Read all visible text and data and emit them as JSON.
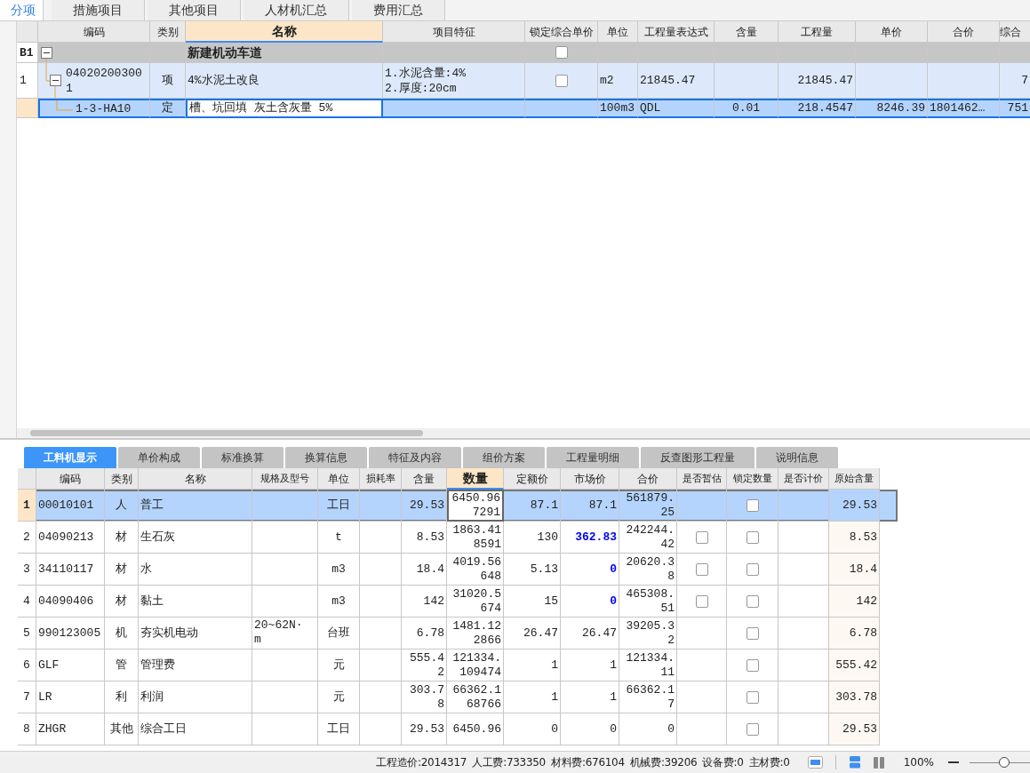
{
  "top_tabs": [
    {
      "label": "分项",
      "selected": true
    },
    {
      "label": "措施项目",
      "selected": false
    },
    {
      "label": "其他项目",
      "selected": false
    },
    {
      "label": "人材机汇总",
      "selected": false
    },
    {
      "label": "费用汇总",
      "selected": false
    }
  ],
  "top_grid": {
    "columns": [
      {
        "selected": false
      },
      {
        "label": "编码",
        "selected": false
      },
      {
        "label": "类别",
        "selected": false
      },
      {
        "label": "名称",
        "selected": true
      },
      {
        "label": "项目特征",
        "selected": false
      },
      {
        "label": "锁定综合单价",
        "selected": false
      },
      {
        "label": "单位",
        "selected": false
      },
      {
        "label": "工程量表达式",
        "selected": false
      },
      {
        "label": "含量",
        "selected": false
      },
      {
        "label": "工程量",
        "selected": false
      },
      {
        "label": "单价",
        "selected": false
      },
      {
        "label": "合价",
        "selected": false
      },
      {
        "label": "综合",
        "selected": false
      }
    ],
    "rows": [
      {
        "kind": "section",
        "row_header": "B1",
        "name": "新建机动车道",
        "locked": false,
        "expanded": true,
        "selected": false,
        "children": [
          {
            "kind": "item",
            "row_header": "1",
            "code": "040202003001",
            "type": "项",
            "name": "4%水泥土改良",
            "features": [
              "1.水泥含量:4%",
              "2.厚度:20cm"
            ],
            "locked": false,
            "unit": "m2",
            "expression": "21845.47",
            "quantity": "21845.47",
            "column_13": "7",
            "expanded": true,
            "selected": false,
            "children": [
              {
                "kind": "quota",
                "code": "1-3-HA10",
                "type": "定",
                "name": "槽、坑回填 灰土含灰量 5%",
                "unit": "100m3",
                "expression": "QDL",
                "content": "0.01",
                "quantity": "218.4547",
                "unit_price": "8246.39",
                "total": "1801462…",
                "column_13": "751",
                "selected": true
              }
            ]
          }
        ]
      }
    ]
  },
  "detail_tabs": [
    {
      "label": "工料机显示",
      "selected": true
    },
    {
      "label": "单价构成",
      "selected": false
    },
    {
      "label": "标准换算",
      "selected": false
    },
    {
      "label": "换算信息",
      "selected": false
    },
    {
      "label": "特征及内容",
      "selected": false
    },
    {
      "label": "组价方案",
      "selected": false
    },
    {
      "label": "工程量明细",
      "selected": false
    },
    {
      "label": "反查图形工程量",
      "selected": false
    },
    {
      "label": "说明信息",
      "selected": false
    }
  ],
  "detail_grid": {
    "columns": [
      {
        "selected": false
      },
      {
        "label": "编码",
        "selected": false
      },
      {
        "label": "类别",
        "selected": false
      },
      {
        "label": "名称",
        "selected": false
      },
      {
        "label": "规格及型号",
        "selected": false
      },
      {
        "label": "单位",
        "selected": false
      },
      {
        "label": "损耗率",
        "selected": false
      },
      {
        "label": "含量",
        "selected": false
      },
      {
        "label": "数量",
        "selected": true
      },
      {
        "label": "定额价",
        "selected": false
      },
      {
        "label": "市场价",
        "selected": false
      },
      {
        "label": "合价",
        "selected": false
      },
      {
        "label": "是否暂估",
        "selected": false
      },
      {
        "label": "锁定数量",
        "selected": false
      },
      {
        "label": "是否计价",
        "selected": false
      },
      {
        "label": "原始含量",
        "selected": false
      }
    ],
    "rows": [
      {
        "index": "1",
        "code": "00010101",
        "type": "人",
        "name": "普工",
        "unit": "工日",
        "content": "29.53",
        "quantity": "6450.967291",
        "quota_price": "87.1",
        "market_price": "87.1",
        "market_price_changed": false,
        "total": "561879.25",
        "quantity_locked": false,
        "original_content": "29.53",
        "selected": true
      },
      {
        "index": "2",
        "code": "04090213",
        "type": "材",
        "name": "生石灰",
        "unit": "t",
        "content": "8.53",
        "quantity": "1863.418591",
        "quota_price": "130",
        "market_price": "362.83",
        "market_price_changed": true,
        "total": "242244.42",
        "estimated": false,
        "quantity_locked": false,
        "original_content": "8.53",
        "selected": false
      },
      {
        "index": "3",
        "code": "34110117",
        "type": "材",
        "name": "水",
        "unit": "m3",
        "content": "18.4",
        "quantity": "4019.56648",
        "quota_price": "5.13",
        "market_price": "0",
        "market_price_changed": true,
        "total": "20620.38",
        "estimated": false,
        "quantity_locked": false,
        "original_content": "18.4",
        "selected": false
      },
      {
        "index": "4",
        "code": "04090406",
        "type": "材",
        "name": "黏土",
        "unit": "m3",
        "content": "142",
        "quantity": "31020.5674",
        "quota_price": "15",
        "market_price": "0",
        "market_price_changed": true,
        "total": "465308.51",
        "estimated": false,
        "quantity_locked": false,
        "original_content": "142",
        "selected": false
      },
      {
        "index": "5",
        "code": "990123005",
        "type": "机",
        "name": "夯实机电动",
        "spec": "20~62N·m",
        "unit": "台班",
        "content": "6.78",
        "quantity": "1481.122866",
        "quota_price": "26.47",
        "market_price": "26.47",
        "market_price_changed": false,
        "total": "39205.32",
        "quantity_locked": false,
        "original_content": "6.78",
        "selected": false
      },
      {
        "index": "6",
        "code": "GLF",
        "type": "管",
        "name": "管理费",
        "unit": "元",
        "content": "555.42",
        "quantity": "121334.109474",
        "quota_price": "1",
        "market_price": "1",
        "market_price_changed": false,
        "total": "121334.11",
        "quantity_locked": false,
        "original_content": "555.42",
        "selected": false
      },
      {
        "index": "7",
        "code": "LR",
        "type": "利",
        "name": "利润",
        "unit": "元",
        "content": "303.78",
        "quantity": "66362.168766",
        "quota_price": "1",
        "market_price": "1",
        "market_price_changed": false,
        "total": "66362.17",
        "quantity_locked": false,
        "original_content": "303.78",
        "selected": false
      },
      {
        "index": "8",
        "code": "ZHGR",
        "type": "其他",
        "name": "综合工日",
        "unit": "工日",
        "content": "29.53",
        "quantity": "6450.96",
        "quota_price": "0",
        "market_price": "0",
        "market_price_changed": false,
        "total": "0",
        "quantity_locked": false,
        "original_content": "29.53",
        "selected": false
      }
    ]
  },
  "status_bar": {
    "totals": [
      "工程造价:2014317",
      "人工费:733350",
      "材料费:676104",
      "机械费:39206",
      "设备费:0",
      "主材费:0"
    ],
    "zoom": "100%",
    "zoom_slider": {
      "level": 0.55
    }
  }
}
